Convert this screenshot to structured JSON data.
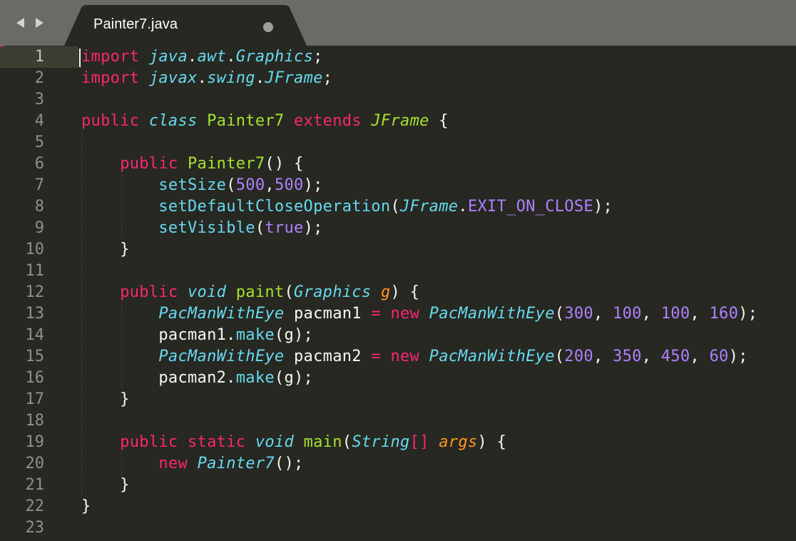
{
  "tab": {
    "title": "Painter7.java",
    "dirty": true
  },
  "nav": {
    "back_icon": "chevron-left-icon",
    "forward_icon": "chevron-right-icon"
  },
  "colors": {
    "background": "#272822",
    "tabbar": "#6a6a66",
    "keyword": "#f92672",
    "type": "#66d9ef",
    "class_name": "#a6e22e",
    "number": "#ae81ff",
    "parameter": "#fd971f",
    "text": "#f8f8f2",
    "line_number": "#8f908a"
  },
  "editor": {
    "active_line": 1,
    "lines": [
      {
        "n": "1",
        "tokens": [
          [
            "kw",
            "import"
          ],
          [
            "pl",
            " "
          ],
          [
            "ty",
            "java"
          ],
          [
            "pl",
            "."
          ],
          [
            "ty",
            "awt"
          ],
          [
            "pl",
            "."
          ],
          [
            "ty",
            "Graphics"
          ],
          [
            "pl",
            ";"
          ]
        ]
      },
      {
        "n": "2",
        "tokens": [
          [
            "kw",
            "import"
          ],
          [
            "pl",
            " "
          ],
          [
            "ty",
            "javax"
          ],
          [
            "pl",
            "."
          ],
          [
            "ty",
            "swing"
          ],
          [
            "pl",
            "."
          ],
          [
            "ty",
            "JFrame"
          ],
          [
            "pl",
            ";"
          ]
        ]
      },
      {
        "n": "3",
        "tokens": []
      },
      {
        "n": "4",
        "tokens": [
          [
            "kw",
            "public"
          ],
          [
            "pl",
            " "
          ],
          [
            "kwi",
            "class"
          ],
          [
            "pl",
            " "
          ],
          [
            "cls",
            "Painter7"
          ],
          [
            "pl",
            " "
          ],
          [
            "kw",
            "extends"
          ],
          [
            "pl",
            " "
          ],
          [
            "clsi",
            "JFrame"
          ],
          [
            "pl",
            " {"
          ]
        ]
      },
      {
        "n": "5",
        "tokens": []
      },
      {
        "n": "6",
        "tokens": [
          [
            "pl",
            "    "
          ],
          [
            "kw",
            "public"
          ],
          [
            "pl",
            " "
          ],
          [
            "cls",
            "Painter7"
          ],
          [
            "pl",
            "() {"
          ]
        ]
      },
      {
        "n": "7",
        "tokens": [
          [
            "pl",
            "        "
          ],
          [
            "fn",
            "setSize"
          ],
          [
            "pl",
            "("
          ],
          [
            "num",
            "500"
          ],
          [
            "pl",
            ","
          ],
          [
            "num",
            "500"
          ],
          [
            "pl",
            ");"
          ]
        ]
      },
      {
        "n": "8",
        "tokens": [
          [
            "pl",
            "        "
          ],
          [
            "fn",
            "setDefaultCloseOperation"
          ],
          [
            "pl",
            "("
          ],
          [
            "ty",
            "JFrame"
          ],
          [
            "pl",
            "."
          ],
          [
            "num",
            "EXIT_ON_CLOSE"
          ],
          [
            "pl",
            ");"
          ]
        ]
      },
      {
        "n": "9",
        "tokens": [
          [
            "pl",
            "        "
          ],
          [
            "fn",
            "setVisible"
          ],
          [
            "pl",
            "("
          ],
          [
            "num",
            "true"
          ],
          [
            "pl",
            ");"
          ]
        ]
      },
      {
        "n": "10",
        "tokens": [
          [
            "pl",
            "    }"
          ]
        ]
      },
      {
        "n": "11",
        "tokens": []
      },
      {
        "n": "12",
        "tokens": [
          [
            "pl",
            "    "
          ],
          [
            "kw",
            "public"
          ],
          [
            "pl",
            " "
          ],
          [
            "kwi",
            "void"
          ],
          [
            "pl",
            " "
          ],
          [
            "cls",
            "paint"
          ],
          [
            "pl",
            "("
          ],
          [
            "ty",
            "Graphics"
          ],
          [
            "pl",
            " "
          ],
          [
            "prm",
            "g"
          ],
          [
            "pl",
            ") {"
          ]
        ]
      },
      {
        "n": "13",
        "tokens": [
          [
            "pl",
            "        "
          ],
          [
            "ty",
            "PacManWithEye"
          ],
          [
            "pl",
            " pacman1 "
          ],
          [
            "kw",
            "="
          ],
          [
            "pl",
            " "
          ],
          [
            "kw",
            "new"
          ],
          [
            "pl",
            " "
          ],
          [
            "ty",
            "PacManWithEye"
          ],
          [
            "pl",
            "("
          ],
          [
            "num",
            "300"
          ],
          [
            "pl",
            ", "
          ],
          [
            "num",
            "100"
          ],
          [
            "pl",
            ", "
          ],
          [
            "num",
            "100"
          ],
          [
            "pl",
            ", "
          ],
          [
            "num",
            "160"
          ],
          [
            "pl",
            ");"
          ]
        ]
      },
      {
        "n": "14",
        "tokens": [
          [
            "pl",
            "        pacman1."
          ],
          [
            "fn",
            "make"
          ],
          [
            "pl",
            "(g);"
          ]
        ]
      },
      {
        "n": "15",
        "tokens": [
          [
            "pl",
            "        "
          ],
          [
            "ty",
            "PacManWithEye"
          ],
          [
            "pl",
            " pacman2 "
          ],
          [
            "kw",
            "="
          ],
          [
            "pl",
            " "
          ],
          [
            "kw",
            "new"
          ],
          [
            "pl",
            " "
          ],
          [
            "ty",
            "PacManWithEye"
          ],
          [
            "pl",
            "("
          ],
          [
            "num",
            "200"
          ],
          [
            "pl",
            ", "
          ],
          [
            "num",
            "350"
          ],
          [
            "pl",
            ", "
          ],
          [
            "num",
            "450"
          ],
          [
            "pl",
            ", "
          ],
          [
            "num",
            "60"
          ],
          [
            "pl",
            ");"
          ]
        ]
      },
      {
        "n": "16",
        "tokens": [
          [
            "pl",
            "        pacman2."
          ],
          [
            "fn",
            "make"
          ],
          [
            "pl",
            "(g);"
          ]
        ]
      },
      {
        "n": "17",
        "tokens": [
          [
            "pl",
            "    }"
          ]
        ]
      },
      {
        "n": "18",
        "tokens": []
      },
      {
        "n": "19",
        "tokens": [
          [
            "pl",
            "    "
          ],
          [
            "kw",
            "public"
          ],
          [
            "pl",
            " "
          ],
          [
            "kw",
            "static"
          ],
          [
            "pl",
            " "
          ],
          [
            "kwi",
            "void"
          ],
          [
            "pl",
            " "
          ],
          [
            "cls",
            "main"
          ],
          [
            "pl",
            "("
          ],
          [
            "ty",
            "String"
          ],
          [
            "kw",
            "[]"
          ],
          [
            "pl",
            " "
          ],
          [
            "prm",
            "args"
          ],
          [
            "pl",
            ") {"
          ]
        ]
      },
      {
        "n": "20",
        "tokens": [
          [
            "pl",
            "        "
          ],
          [
            "kw",
            "new"
          ],
          [
            "pl",
            " "
          ],
          [
            "ty",
            "Painter7"
          ],
          [
            "pl",
            "();"
          ]
        ]
      },
      {
        "n": "21",
        "tokens": [
          [
            "pl",
            "    }"
          ]
        ]
      },
      {
        "n": "22",
        "tokens": [
          [
            "pl",
            "}"
          ]
        ]
      },
      {
        "n": "23",
        "tokens": []
      }
    ]
  }
}
